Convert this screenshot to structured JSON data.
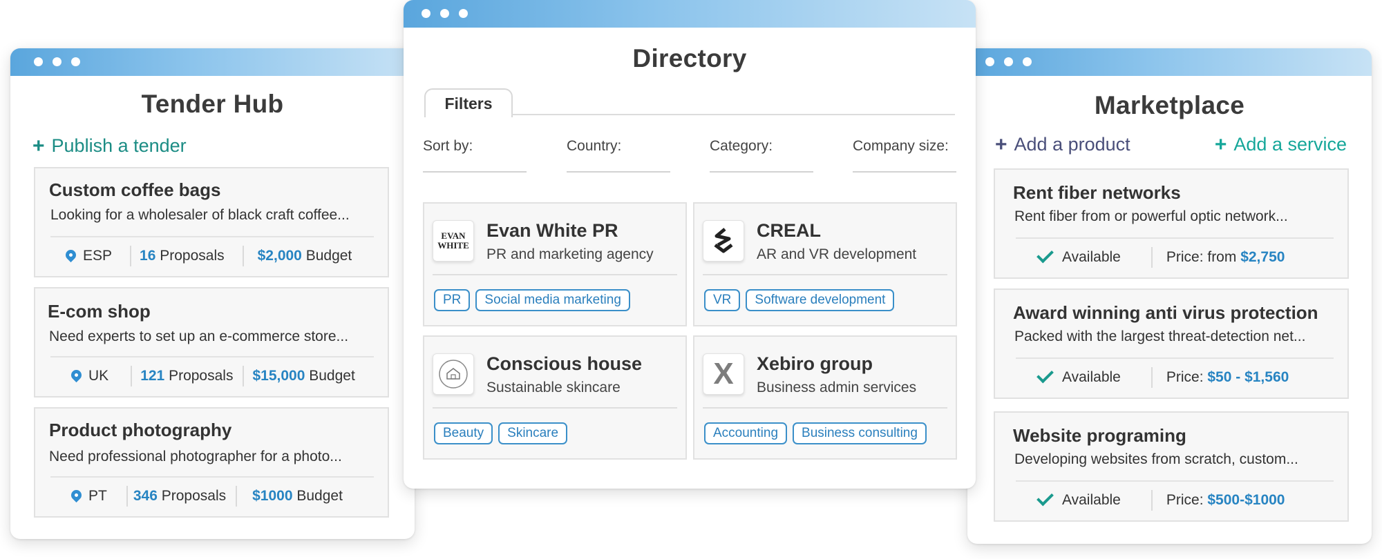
{
  "tender_hub": {
    "title": "Tender Hub",
    "publish_label": "Publish a tender",
    "cards": [
      {
        "title": "Custom coffee bags",
        "desc": "Looking for a wholesaler of black craft coffee...",
        "location": "ESP",
        "proposals": "16",
        "proposals_label": "Proposals",
        "budget": "$2,000",
        "budget_label": "Budget"
      },
      {
        "title": "E-com shop",
        "desc": "Need experts to set up an e-commerce store...",
        "location": "UK",
        "proposals": "121",
        "proposals_label": "Proposals",
        "budget": "$15,000",
        "budget_label": "Budget"
      },
      {
        "title": "Product photography",
        "desc": "Need professional photographer for a photo...",
        "location": "PT",
        "proposals": "346",
        "proposals_label": "Proposals",
        "budget": "$1000",
        "budget_label": "Budget"
      }
    ]
  },
  "directory": {
    "title": "Directory",
    "tab_label": "Filters",
    "filters": [
      "Sort by:",
      "Country:",
      "Category:",
      "Company size:"
    ],
    "companies": [
      {
        "name": "Evan White PR",
        "desc": "PR and marketing agency",
        "logo_text": "EVAN WHITE",
        "tags": [
          "PR",
          "Social media marketing"
        ]
      },
      {
        "name": "CREAL",
        "desc": "AR and VR development",
        "logo_text": "",
        "tags": [
          "VR",
          "Software development"
        ]
      },
      {
        "name": "Conscious house",
        "desc": "Sustainable skincare",
        "logo_text": "",
        "tags": [
          "Beauty",
          "Skincare"
        ]
      },
      {
        "name": "Xebiro group",
        "desc": "Business admin services",
        "logo_text": "X",
        "tags": [
          "Accounting",
          "Business consulting"
        ]
      }
    ]
  },
  "marketplace": {
    "title": "Marketplace",
    "add_product_label": "Add a product",
    "add_service_label": "Add a service",
    "cards": [
      {
        "title": "Rent fiber networks",
        "desc": "Rent fiber from or powerful optic network...",
        "status": "Available",
        "price_label": "Price: from",
        "price": "$2,750"
      },
      {
        "title": "Award winning anti virus protection",
        "desc": "Packed with the largest threat-detection net...",
        "status": "Available",
        "price_label": "Price:",
        "price": "$50 - $1,560"
      },
      {
        "title": "Website programing",
        "desc": "Developing websites from scratch, custom...",
        "status": "Available",
        "price_label": "Price:",
        "price": "$500-$1000"
      }
    ]
  },
  "colors": {
    "accent_teal": "#1b8c84",
    "accent_blue": "#2784c2",
    "marketplace_product": "#4a4f7a",
    "marketplace_service": "#16a79a"
  }
}
